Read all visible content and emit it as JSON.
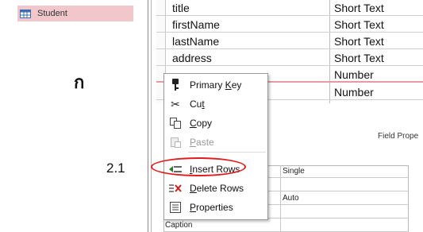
{
  "nav": {
    "item_label": "Student",
    "highlight_color": "#f1c7cb"
  },
  "thai_text": "ก",
  "step_label": "2.1",
  "fields": [
    {
      "name": "title",
      "type": "Short Text"
    },
    {
      "name": "firstName",
      "type": "Short Text"
    },
    {
      "name": "lastName",
      "type": "Short Text"
    },
    {
      "name": "address",
      "type": "Short Text"
    },
    {
      "name": "",
      "type": "Number"
    },
    {
      "name": "",
      "type": "Number"
    }
  ],
  "field_properties_label": "Field Prope",
  "properties": [
    {
      "name": "",
      "value": "Single"
    },
    {
      "name": "",
      "value": ""
    },
    {
      "name": "",
      "value": "Auto"
    },
    {
      "name": "",
      "value": ""
    },
    {
      "name": "Caption",
      "value": ""
    }
  ],
  "context_menu": {
    "items": [
      {
        "icon": "key-icon",
        "pre": "Primary ",
        "acc": "K",
        "post": "ey",
        "enabled": true
      },
      {
        "icon": "scissors-icon",
        "pre": "Cu",
        "acc": "t",
        "post": "",
        "enabled": true
      },
      {
        "icon": "copy-icon",
        "pre": "",
        "acc": "C",
        "post": "opy",
        "enabled": true
      },
      {
        "icon": "paste-icon",
        "pre": "",
        "acc": "P",
        "post": "aste",
        "enabled": false
      },
      {
        "icon": "insert-rows-icon",
        "pre": "",
        "acc": "I",
        "post": "nsert Rows",
        "enabled": true
      },
      {
        "icon": "delete-rows-icon",
        "pre": "",
        "acc": "D",
        "post": "elete Rows",
        "enabled": true
      },
      {
        "icon": "properties-icon",
        "pre": "",
        "acc": "P",
        "post": "roperties",
        "enabled": true
      }
    ]
  },
  "annotation_color": "#e01e1e"
}
